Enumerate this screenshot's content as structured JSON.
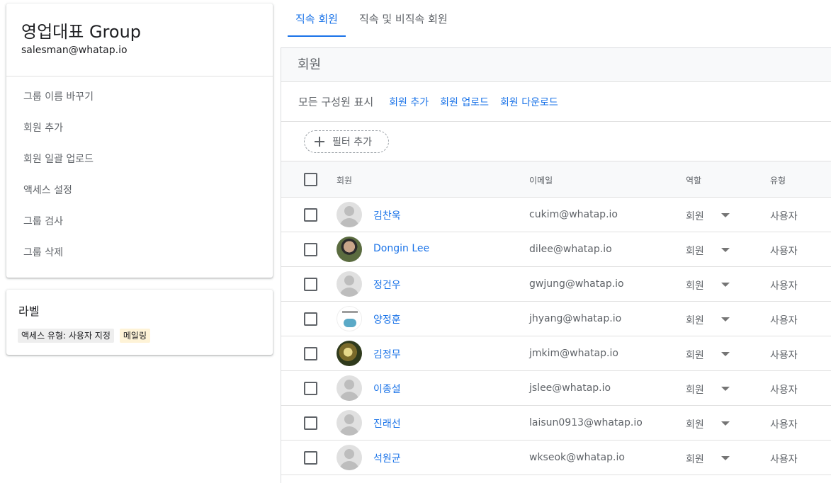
{
  "group": {
    "title": "영업대표 Group",
    "email": "salesman@whatap.io",
    "menu": [
      "그룹 이름 바꾸기",
      "회원 추가",
      "회원 일괄 업로드",
      "액세스 설정",
      "그룹 검사",
      "그룹 삭제"
    ]
  },
  "labels": {
    "title": "라벨",
    "chips": [
      "액세스 유형: 사용자 지정",
      "메일링"
    ]
  },
  "tabs": [
    "직속 회원",
    "직속 및 비직속 회원"
  ],
  "panel": {
    "title": "회원",
    "show_all": "모든 구성원 표시",
    "actions": [
      "회원 추가",
      "회원 업로드",
      "회원 다운로드"
    ],
    "filter_label": "필터 추가"
  },
  "table": {
    "headers": {
      "member": "회원",
      "email": "이메일",
      "role": "역할",
      "type": "유형"
    },
    "rows": [
      {
        "name": "김찬욱",
        "email": "cukim@whatap.io",
        "role": "회원",
        "type": "사용자",
        "avatar": "default"
      },
      {
        "name": "Dongin Lee",
        "email": "dilee@whatap.io",
        "role": "회원",
        "type": "사용자",
        "avatar": "photo1"
      },
      {
        "name": "정건우",
        "email": "gwjung@whatap.io",
        "role": "회원",
        "type": "사용자",
        "avatar": "default"
      },
      {
        "name": "양정훈",
        "email": "jhyang@whatap.io",
        "role": "회원",
        "type": "사용자",
        "avatar": "photo2"
      },
      {
        "name": "김정무",
        "email": "jmkim@whatap.io",
        "role": "회원",
        "type": "사용자",
        "avatar": "photo3"
      },
      {
        "name": "이종설",
        "email": "jslee@whatap.io",
        "role": "회원",
        "type": "사용자",
        "avatar": "default"
      },
      {
        "name": "진래선",
        "email": "laisun0913@whatap.io",
        "role": "회원",
        "type": "사용자",
        "avatar": "default"
      },
      {
        "name": "석원균",
        "email": "wkseok@whatap.io",
        "role": "회원",
        "type": "사용자",
        "avatar": "default"
      }
    ]
  },
  "colors": {
    "accent": "#1a73e8",
    "text_secondary": "#5f6368"
  }
}
